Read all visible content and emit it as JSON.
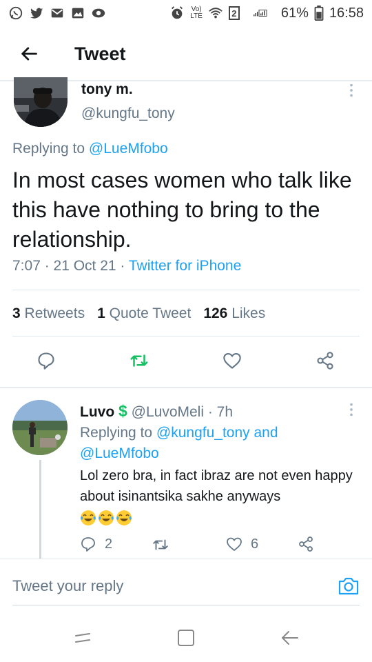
{
  "status_bar": {
    "volte_top": "Vo)",
    "volte_bottom": "LTE",
    "sim_slot": "2",
    "battery_percent": "61%",
    "time": "16:58"
  },
  "header": {
    "title": "Tweet"
  },
  "main_tweet": {
    "author_name": "tony m.",
    "author_handle": "@kungfu_tony",
    "replying_prefix": "Replying to ",
    "replying_to": "@LueMfobo",
    "text": "In most cases women who talk like this have nothing to bring to the relationship.",
    "time_date": "7:07 · 21 Oct 21 · ",
    "source": "Twitter for iPhone",
    "stats": {
      "retweets_count": "3",
      "retweets_label": "Retweets",
      "quotes_count": "1",
      "quotes_label": "Quote Tweet",
      "likes_count": "126",
      "likes_label": "Likes"
    }
  },
  "reply_tweet": {
    "author_name": "Luvo",
    "author_badge": "$",
    "author_handle": "@LuvoMeli",
    "time_ago": "· 7h",
    "replying_prefix": "Replying to ",
    "replying_to_1": "@kungfu_tony",
    "replying_join": " and ",
    "replying_to_2": "@LueMfobo",
    "text": "Lol zero bra, in fact ibraz are not even happy about isinantsika sakhe anyways",
    "emoji_count": 3,
    "reply_count": "2",
    "retweet_count": "",
    "like_count": "6"
  },
  "composer": {
    "placeholder": "Tweet your reply"
  },
  "colors": {
    "accent": "#1da1f2",
    "retweet_green": "#17bf63",
    "muted": "#657786",
    "text": "#14171a"
  }
}
